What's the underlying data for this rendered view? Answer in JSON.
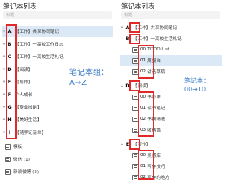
{
  "left": {
    "title": "笔记本列表",
    "search_placeholder": "标题",
    "groups": [
      {
        "letter": "A",
        "label": "【工作】共享协同笔记"
      },
      {
        "letter": "B",
        "label": "【工作】一高校工作日志"
      },
      {
        "letter": "C",
        "label": "【工作】一高校生活札记"
      },
      {
        "letter": "D",
        "label": "【阅读】"
      },
      {
        "letter": "E",
        "label": "【写作】"
      },
      {
        "letter": "F",
        "label": "个人成长"
      },
      {
        "letter": "G",
        "label": "【专业技能】"
      },
      {
        "letter": "H",
        "label": "【美好生活】"
      },
      {
        "letter": "I",
        "label": "【随手记清单】"
      }
    ],
    "extras": [
      {
        "label": "模板"
      },
      {
        "label": "微信 (1)"
      },
      {
        "label": "新浪微博 (2)"
      }
    ]
  },
  "right": {
    "title": "笔记本列表",
    "search_placeholder": "标题",
    "group_a": {
      "letter": "A",
      "label": "【工作】共享协同笔记"
    },
    "group_b": {
      "letter": "B",
      "label": "【工作】一高校生活札记"
    },
    "b_items": [
      {
        "num": "00",
        "label": "TODO List"
      },
      {
        "num": "01",
        "label": "周报自"
      },
      {
        "num": "02",
        "label": "讲话草稿"
      }
    ],
    "group_d": {
      "letter": "D",
      "label": "【阅读】"
    },
    "d_items": [
      {
        "num": "00",
        "label": "书影单"
      },
      {
        "num": "01",
        "label": "读书笔记"
      },
      {
        "num": "02",
        "label": "书摘精选"
      },
      {
        "num": "03",
        "label": "收纳篇"
      }
    ],
    "group_e": {
      "letter": "E",
      "label": "【写作】"
    },
    "e_items": [
      {
        "num": "00",
        "label": "灵感库"
      },
      {
        "num": "01",
        "label": "写作技巧"
      },
      {
        "num": "02",
        "label": "写作的地方"
      }
    ]
  },
  "annotations": {
    "groups_line1": "笔记本组：",
    "groups_line2": "A→Z",
    "notebooks_line1": "笔记本：",
    "notebooks_line2": "00→10"
  }
}
